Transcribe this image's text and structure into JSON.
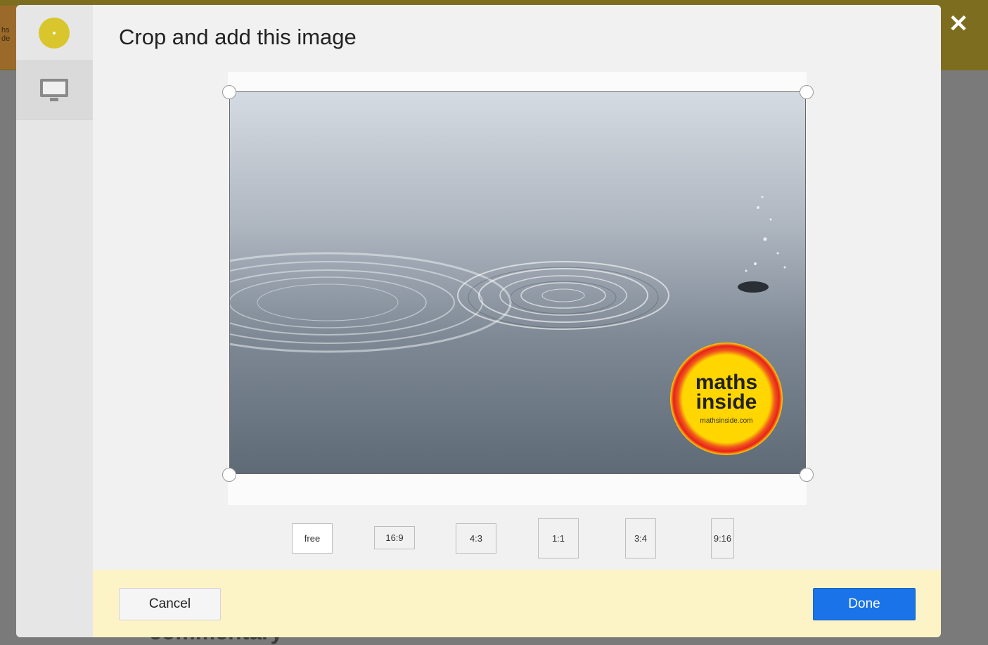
{
  "modal": {
    "title": "Crop and add this image",
    "close_icon": "close-icon"
  },
  "sidebar": {
    "logo_icon": "app-logo-icon",
    "tab_icon": "monitor-icon"
  },
  "image": {
    "logo_text_line1": "maths",
    "logo_text_line2": "inside",
    "logo_url": "mathsinside.com"
  },
  "aspect_ratios": [
    "free",
    "16:9",
    "4:3",
    "1:1",
    "3:4",
    "9:16"
  ],
  "selected_ratio": "free",
  "footer": {
    "cancel_label": "Cancel",
    "done_label": "Done"
  },
  "background_page": {
    "partial_logo": [
      "hs",
      "de"
    ],
    "partial_heading": "commentary"
  },
  "colors": {
    "accent_blue": "#1a73e8",
    "footer_bg": "#fcf3c6",
    "logo_yellow": "#d9c62d",
    "topbar_olive": "#7d6e1f"
  }
}
